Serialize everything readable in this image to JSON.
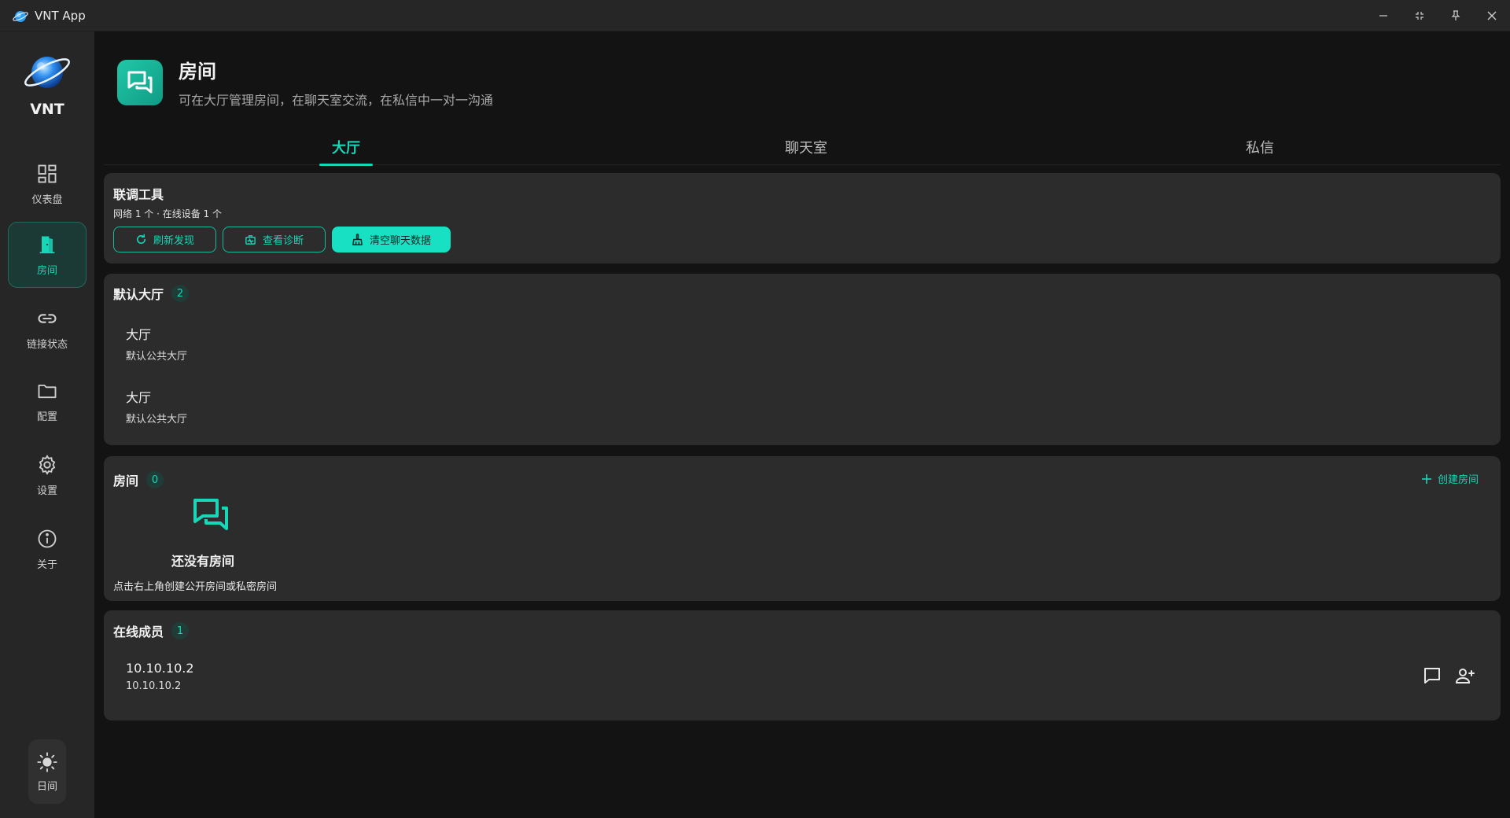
{
  "window": {
    "title": "VNT App",
    "controls": [
      "minimize",
      "restore",
      "pin",
      "close"
    ]
  },
  "brand": {
    "name": "VNT"
  },
  "sidebar": {
    "items": [
      {
        "label": "仪表盘",
        "icon": "dashboard-icon"
      },
      {
        "label": "房间",
        "icon": "door-icon",
        "active": true
      },
      {
        "label": "链接状态",
        "icon": "link-icon"
      },
      {
        "label": "配置",
        "icon": "folder-icon"
      },
      {
        "label": "设置",
        "icon": "gear-icon"
      },
      {
        "label": "关于",
        "icon": "info-icon"
      }
    ],
    "theme_toggle": {
      "label": "日间",
      "icon": "sun-icon"
    }
  },
  "header": {
    "title": "房间",
    "subtitle": "可在大厅管理房间，在聊天室交流，在私信中一对一沟通"
  },
  "tabs": [
    {
      "label": "大厅",
      "active": true
    },
    {
      "label": "聊天室"
    },
    {
      "label": "私信"
    }
  ],
  "tools": {
    "title": "联调工具",
    "summary": "网络 1 个 · 在线设备 1 个",
    "buttons": {
      "refresh": "刷新发现",
      "diagnose": "查看诊断",
      "clear": "清空聊天数据"
    }
  },
  "default_lobby": {
    "title": "默认大厅",
    "count": "2",
    "items": [
      {
        "name": "大厅",
        "desc": "默认公共大厅"
      },
      {
        "name": "大厅",
        "desc": "默认公共大厅"
      }
    ]
  },
  "rooms": {
    "title": "房间",
    "count": "0",
    "create_label": "创建房间",
    "empty_title": "还没有房间",
    "empty_hint": "点击右上角创建公开房间或私密房间"
  },
  "members": {
    "title": "在线成员",
    "count": "1",
    "items": [
      {
        "name": "10.10.10.2",
        "ip": "10.10.10.2"
      }
    ]
  },
  "colors": {
    "accent": "#18d6b8",
    "background": "#131313",
    "panel": "#2c2c2c",
    "sidebar": "#262626"
  }
}
